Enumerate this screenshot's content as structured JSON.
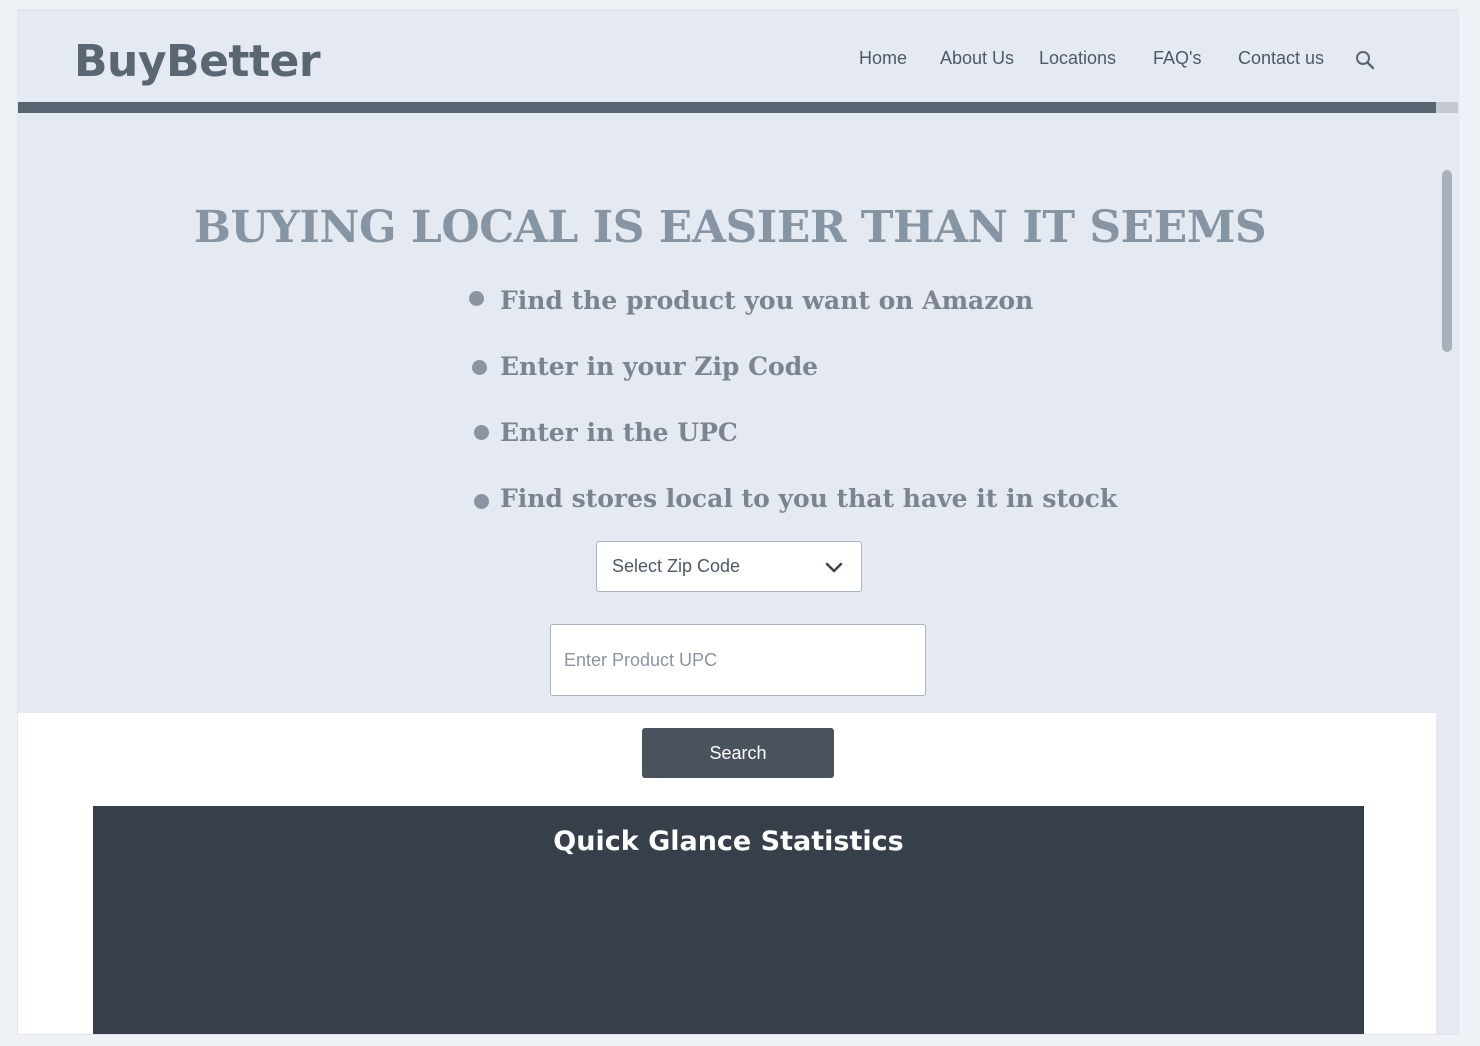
{
  "brand": {
    "logo": "BuyBetter"
  },
  "nav": {
    "items": [
      {
        "label": "Home"
      },
      {
        "label": "About Us"
      },
      {
        "label": "Locations"
      },
      {
        "label": "FAQ's"
      },
      {
        "label": "Contact us"
      }
    ],
    "search_icon": "search-icon"
  },
  "hero": {
    "headline": "BUYING LOCAL IS EASIER THAN IT SEEMS",
    "steps": [
      "Find the product you want on Amazon",
      "Enter in your Zip Code",
      "Enter in the UPC",
      "Find stores local to you that have it in stock"
    ]
  },
  "form": {
    "zip_select": {
      "selected": "Select Zip Code"
    },
    "upc_input": {
      "placeholder": "Enter Product UPC",
      "value": ""
    },
    "search_label": "Search"
  },
  "stats": {
    "title": "Quick Glance Statistics"
  },
  "colors": {
    "bar": "#5a6573",
    "stats_bg": "#363f4a",
    "button": "#4a525d",
    "page_bg": "#e5e9f1"
  }
}
